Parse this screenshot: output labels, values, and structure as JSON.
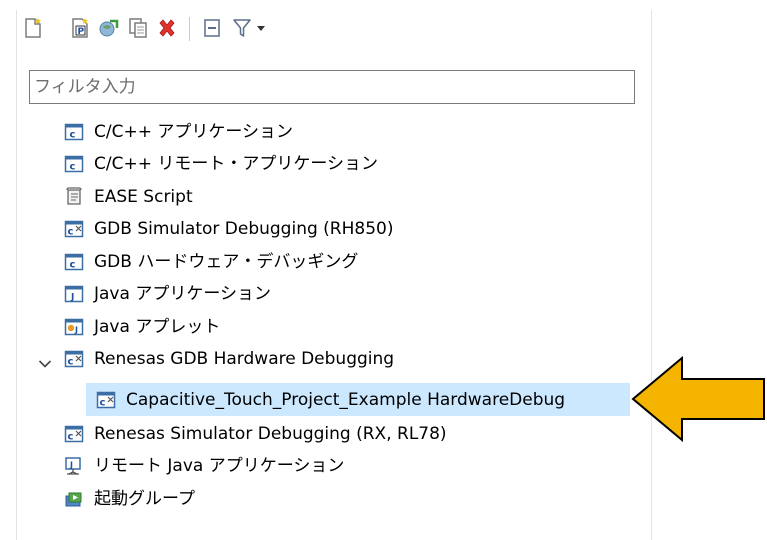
{
  "filter": {
    "placeholder": "フィルタ入力"
  },
  "toolbar": {
    "buttons": [
      "new-configuration-icon",
      "new-prototype-icon",
      "export-icon",
      "duplicate-icon",
      "delete-icon",
      "collapse-all-icon",
      "filter-icon",
      "dropdown-arrow-icon"
    ]
  },
  "tree": {
    "items": [
      {
        "label": "C/C++ アプリケーション",
        "icon": "c-app-icon"
      },
      {
        "label": "C/C++ リモート・アプリケーション",
        "icon": "c-app-icon"
      },
      {
        "label": "EASE Script",
        "icon": "script-icon"
      },
      {
        "label": "GDB Simulator Debugging (RH850)",
        "icon": "c-debug-icon"
      },
      {
        "label": "GDB ハードウェア・デバッギング",
        "icon": "c-app-icon"
      },
      {
        "label": "Java アプリケーション",
        "icon": "java-app-icon"
      },
      {
        "label": "Java アプレット",
        "icon": "java-applet-icon"
      },
      {
        "label": "Renesas GDB Hardware Debugging",
        "icon": "c-debug-icon",
        "expanded": true,
        "children": [
          {
            "label": "Capacitive_Touch_Project_Example HardwareDebug",
            "icon": "c-debug-icon",
            "selected": true
          }
        ]
      },
      {
        "label": "Renesas Simulator Debugging (RX, RL78)",
        "icon": "c-debug-icon"
      },
      {
        "label": "リモート Java アプリケーション",
        "icon": "remote-java-icon"
      },
      {
        "label": "起動グループ",
        "icon": "launch-group-icon"
      }
    ]
  },
  "annotation": {
    "color": "#f5b400",
    "outline": "#000000"
  },
  "colors": {
    "selection": "#cce8ff",
    "accent": "#1f6fc5"
  }
}
